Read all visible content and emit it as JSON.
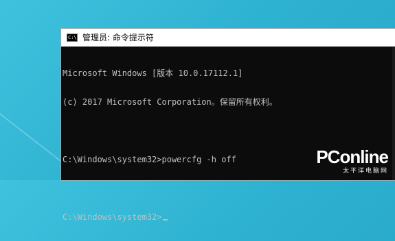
{
  "window": {
    "title": "管理员: 命令提示符",
    "icon": "cmd-icon",
    "icon_text": "C:\\"
  },
  "console": {
    "lines": [
      "Microsoft Windows [版本 10.0.17112.1]",
      "(c) 2017 Microsoft Corporation。保留所有权利。",
      "",
      "C:\\Windows\\system32>powercfg -h off",
      "",
      "C:\\Windows\\system32>"
    ]
  },
  "watermark": {
    "brand": "PConline",
    "sub": "太平洋电脑网"
  },
  "colors": {
    "desktop": "#2fb3d2",
    "console_bg": "#0c0c0c",
    "console_text": "#c0c0c0"
  }
}
